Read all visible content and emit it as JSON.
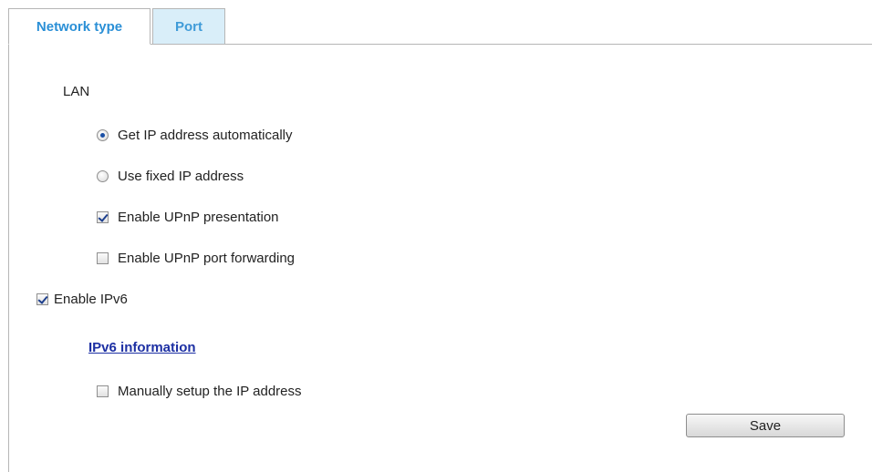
{
  "tabs": [
    {
      "label": "Network type",
      "active": true
    },
    {
      "label": "Port",
      "active": false
    }
  ],
  "lan": {
    "heading": "LAN",
    "options": [
      {
        "label": "Get IP address automatically",
        "type": "radio",
        "checked": true
      },
      {
        "label": "Use fixed IP address",
        "type": "radio",
        "checked": false
      },
      {
        "label": "Enable UPnP presentation",
        "type": "checkbox",
        "checked": true
      },
      {
        "label": "Enable UPnP port forwarding",
        "type": "checkbox",
        "checked": false
      }
    ]
  },
  "ipv6": {
    "enable_label": "Enable IPv6",
    "enable_checked": true,
    "info_link": "IPv6 information",
    "manual_label": "Manually setup the IP address",
    "manual_checked": false
  },
  "actions": {
    "save_label": "Save"
  },
  "colors": {
    "tab_text": "#2a8fd6",
    "inactive_tab_bg": "#d9eef9",
    "link": "#1c2fa3",
    "border": "#b6b6b6"
  }
}
